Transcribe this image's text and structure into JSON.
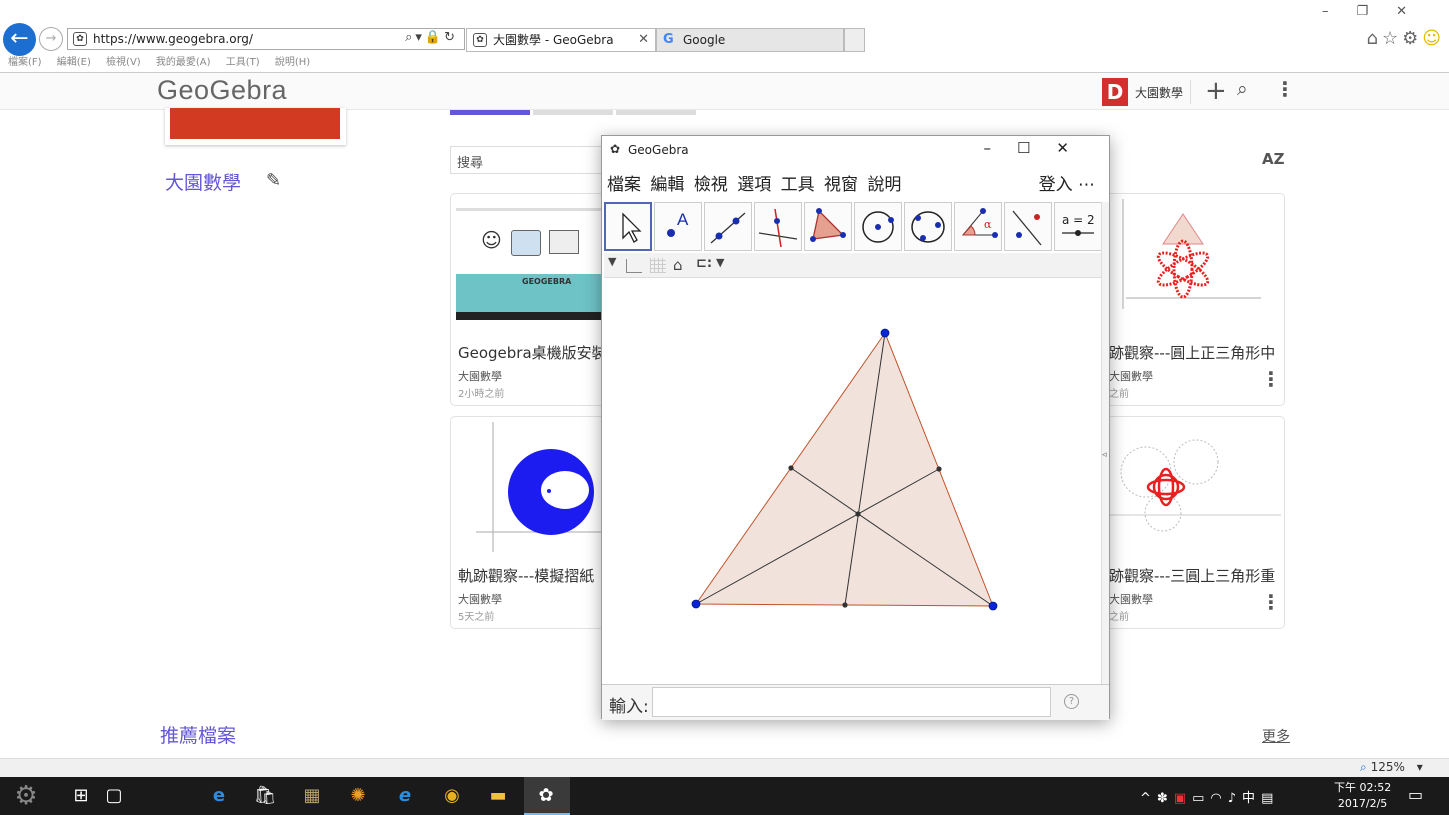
{
  "browser": {
    "url": "https://www.geogebra.org/",
    "tabs": [
      {
        "label": "大園數學 - GeoGebra"
      },
      {
        "label": "Google"
      }
    ],
    "menu": [
      "檔案(F)",
      "編輯(E)",
      "檢視(V)",
      "我的最愛(A)",
      "工具(T)",
      "說明(H)"
    ],
    "zoom": "125%"
  },
  "site": {
    "logo": "GeoGebra",
    "user_initial": "D",
    "user_name": "大園數學",
    "profile_name": "大園數學",
    "search_placeholder": "搜尋",
    "sort_label": "AZ",
    "cards": [
      {
        "title": "Geogebra桌機版安裝",
        "author": "大園數學",
        "time": "2小時之前",
        "thumb_heading": "GEOGEBRA"
      },
      {
        "title": "跡觀察---圓上正三角形中",
        "author": "大園數學",
        "time": "之前"
      },
      {
        "title": "軌跡觀察---模擬摺紙",
        "author": "大園數學",
        "time": "5天之前"
      },
      {
        "title": "跡觀察---三圓上三角形重",
        "author": "大園數學",
        "time": "之前"
      }
    ],
    "recommended": "推薦檔案",
    "more": "更多"
  },
  "geogebra_window": {
    "title": "GeoGebra",
    "menu": [
      "檔案",
      "編輯",
      "檢視",
      "選項",
      "工具",
      "視窗",
      "說明"
    ],
    "login": "登入",
    "more": "⋯",
    "input_label": "輸入:",
    "help": "?",
    "slider_tool_label": "a = 2",
    "point_tool_label": "A",
    "angle_tool_label": "α"
  },
  "taskbar": {
    "clock_time": "下午 02:52",
    "clock_date": "2017/2/5",
    "ime": "中"
  },
  "colors": {
    "accent": "#6457d6",
    "brand_red": "#d23a22",
    "point": "#0a25d6",
    "triangle_fill": "#f1e3dc",
    "triangle_edge": "#c0532a",
    "taskbar": "#1a1a1a"
  }
}
